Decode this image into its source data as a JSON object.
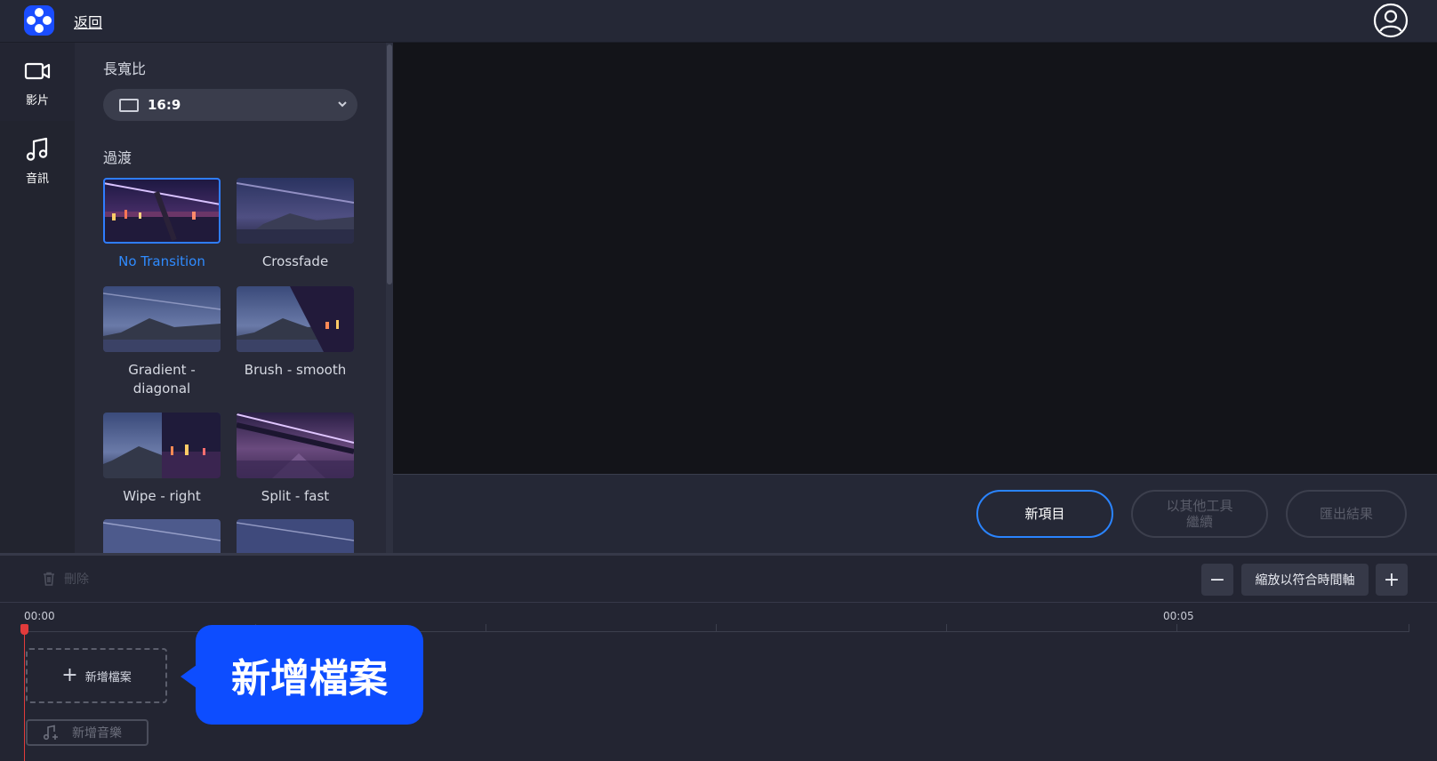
{
  "topbar": {
    "back_label": "返回"
  },
  "rail": {
    "items": [
      {
        "label": "影片",
        "icon": "video-camera-icon"
      },
      {
        "label": "音訊",
        "icon": "music-note-icon"
      }
    ]
  },
  "panel": {
    "aspect_title": "長寬比",
    "aspect_value": "16:9",
    "transition_title": "過渡",
    "transitions": [
      {
        "name": "No Transition",
        "selected": true
      },
      {
        "name": "Crossfade"
      },
      {
        "name": "Gradient - diagonal"
      },
      {
        "name": "Brush - smooth"
      },
      {
        "name": "Wipe - right"
      },
      {
        "name": "Split - fast"
      }
    ]
  },
  "actions": {
    "new_project": "新項目",
    "continue_other": "以其他工具\n繼續",
    "export": "匯出結果"
  },
  "timeline_toolbar": {
    "delete": "刪除",
    "fit": "縮放以符合時間軸",
    "zoom_out": "−",
    "zoom_in": "+"
  },
  "timeline": {
    "start_time": "00:00",
    "mark_time": "00:05",
    "add_file": "新增檔案",
    "add_music": "新增音樂"
  },
  "tooltip": {
    "text": "新增檔案"
  },
  "colors": {
    "accent": "#2a84ff",
    "brand": "#1a4dff",
    "playhead": "#e23b3b",
    "tooltip": "#0d4dff"
  }
}
